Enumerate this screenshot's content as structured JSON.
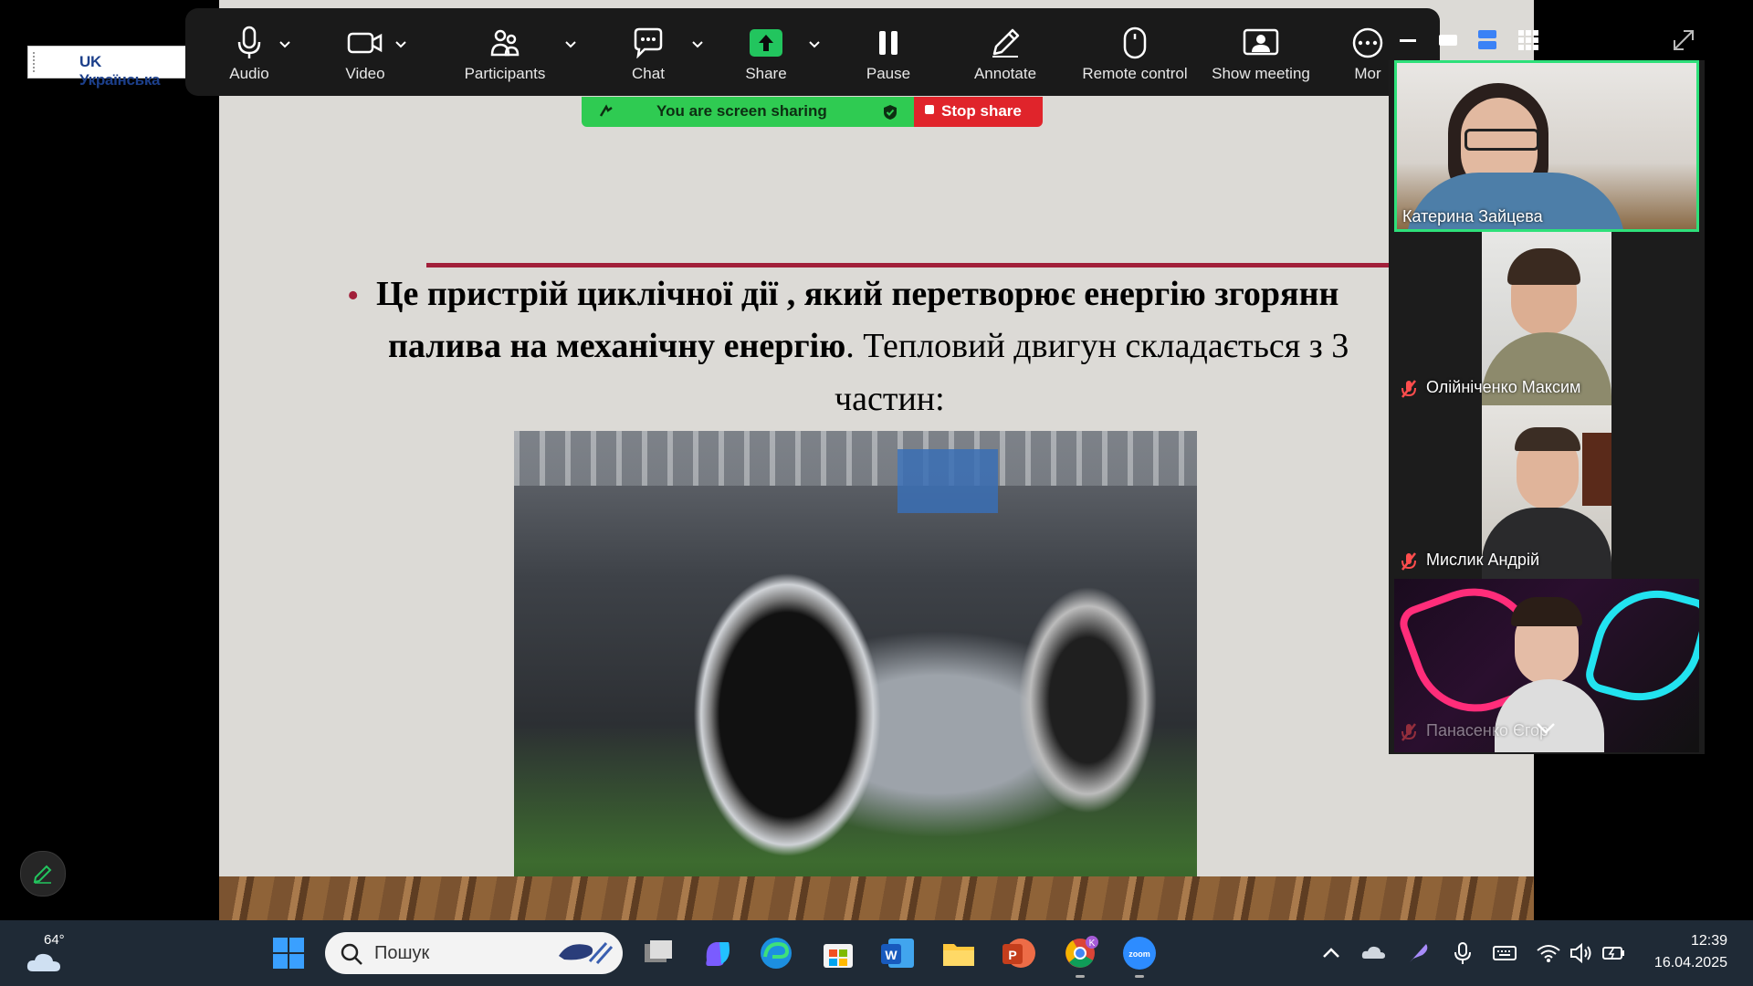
{
  "language_indicator": {
    "label": "UK Українська"
  },
  "toolbar": {
    "items": [
      {
        "label": "Audio",
        "icon": "microphone-icon"
      },
      {
        "label": "Video",
        "icon": "video-camera-icon"
      },
      {
        "label": "Participants",
        "icon": "participants-icon"
      },
      {
        "label": "Chat",
        "icon": "chat-icon"
      },
      {
        "label": "Share",
        "icon": "share-screen-icon"
      },
      {
        "label": "Pause",
        "icon": "pause-icon"
      },
      {
        "label": "Annotate",
        "icon": "pencil-icon"
      },
      {
        "label": "Remote control",
        "icon": "mouse-icon"
      },
      {
        "label": "Show meeting",
        "icon": "show-meeting-icon"
      },
      {
        "label": "Mor",
        "icon": "more-icon"
      }
    ],
    "share_accent": "#22c55e",
    "bg": "#1a1a1a"
  },
  "share_banner": {
    "status": "You are screen sharing",
    "stop": "Stop share"
  },
  "slide": {
    "line1": "Це пристрій циклічної дії , який перетворює енергію згорянн",
    "line2_bold": "палива на механічну енергію",
    "line2_rest": ". Тепловий двигун складається з 3",
    "line3": "частин:",
    "accent": "#a21f3a"
  },
  "participants": [
    {
      "name": "Катерина Зайцева",
      "muted": false,
      "active_speaker": true
    },
    {
      "name": "Олійніченко Максим",
      "muted": true
    },
    {
      "name": "Мислик Андрій",
      "muted": true
    },
    {
      "name": "Панасенко Єгор",
      "muted": true
    }
  ],
  "taskbar": {
    "weather_temp": "64°",
    "search_placeholder": "Пошук",
    "time": "12:39",
    "date": "16.04.2025"
  }
}
